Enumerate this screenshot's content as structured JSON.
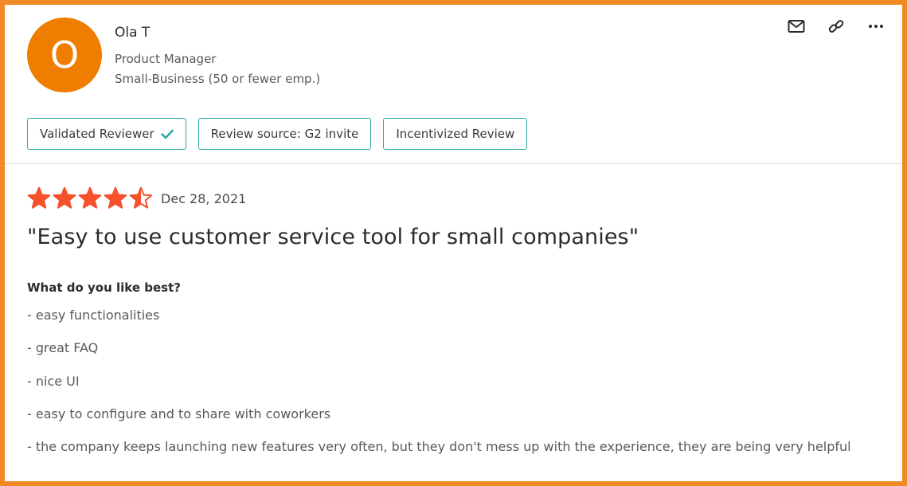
{
  "reviewer": {
    "avatar_letter": "O",
    "avatar_color": "#ef7d00",
    "name": "Ola T",
    "role": "Product Manager",
    "segment": "Small-Business (50 or fewer emp.)"
  },
  "actions": [
    {
      "icon": "mail-icon"
    },
    {
      "icon": "link-icon"
    },
    {
      "icon": "more-icon"
    }
  ],
  "tags": {
    "validated": "Validated Reviewer",
    "source": "Review source: G2 invite",
    "incentivized": "Incentivized Review"
  },
  "review": {
    "rating": 4.5,
    "rating_max": 5,
    "star_color": "#f4512c",
    "date": "Dec 28, 2021",
    "title": "\"Easy to use customer service tool for small companies\"",
    "question": "What do you like best?",
    "answers": [
      "- easy functionalities",
      "- great FAQ",
      "- nice UI",
      "- easy to configure and to share with coworkers",
      "- the company keeps launching new features very often, but they don't mess up with the experience, they are being very helpful"
    ]
  },
  "colors": {
    "frame_border": "#f08a24",
    "tag_border": "#2ea8a8",
    "check": "#2ea8a8"
  }
}
